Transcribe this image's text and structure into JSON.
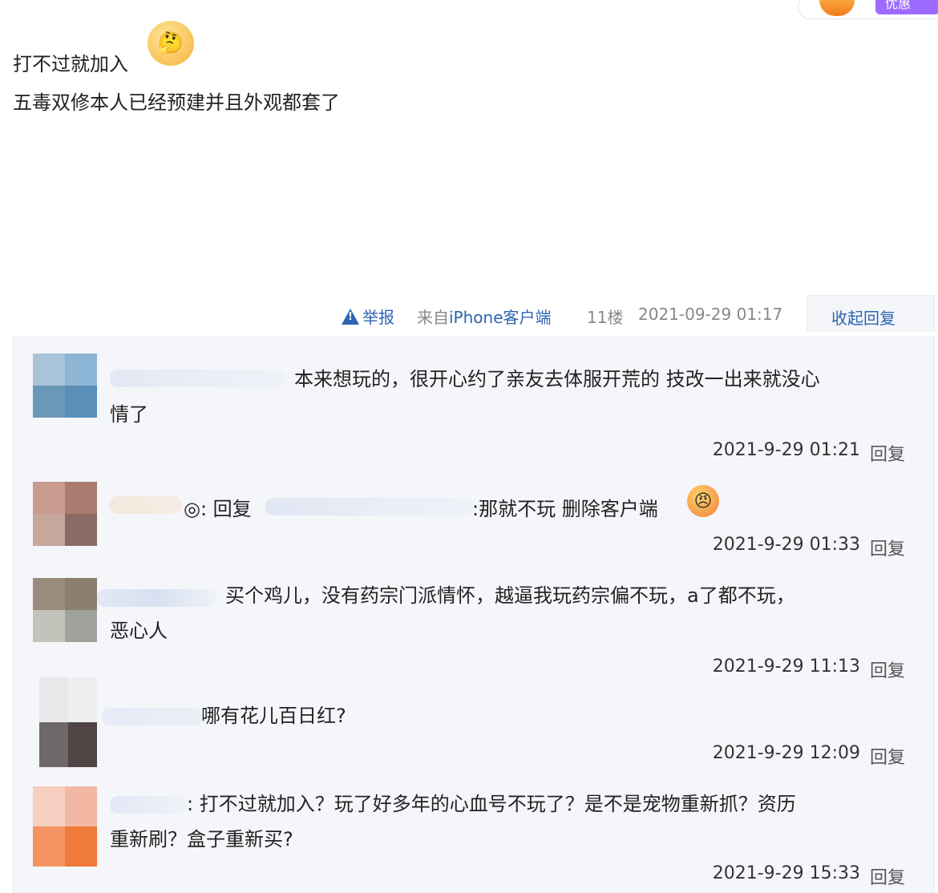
{
  "header_badges": {
    "vip_label": "优惠"
  },
  "post": {
    "line1": "打不过就加入",
    "line2": "五毒双修本人已经预建并且外观都套了",
    "emoji_icon": "thinking-face-icon"
  },
  "meta": {
    "report_label": "举报",
    "source_prefix": "来自",
    "source_client": "iPhone客户端",
    "floor": "11楼",
    "time": "2021-09-29 01:17",
    "collapse_label": "收起回复"
  },
  "replies": [
    {
      "line1": "本来想玩的，很开心约了亲友去体服开荒的 技改一出来就没心",
      "line2": "情了",
      "time": "2021-9-29 01:21",
      "reply_label": "回复"
    },
    {
      "prefix": "◎: 回复",
      "line1": ":那就不玩 删除客户端",
      "time": "2021-9-29 01:33",
      "reply_label": "回复"
    },
    {
      "line1": "买个鸡儿，没有药宗门派情怀，越逼我玩药宗偏不玩，a了都不玩，",
      "line2": "恶心人",
      "time": "2021-9-29 11:13",
      "reply_label": "回复"
    },
    {
      "line1": "哪有花儿百日红?",
      "time": "2021-9-29 12:09",
      "reply_label": "回复"
    },
    {
      "line1": ": 打不过就加入？玩了好多年的心血号不玩了？是不是宠物重新抓？资历",
      "line2": "重新刷？盒子重新买?",
      "time": "2021-9-29 15:33",
      "reply_label": "回复"
    }
  ]
}
